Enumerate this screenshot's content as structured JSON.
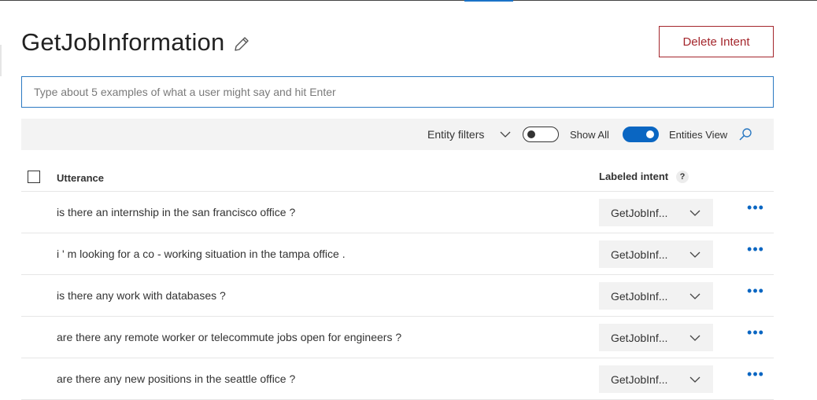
{
  "header": {
    "title": "GetJobInformation",
    "delete_label": "Delete Intent"
  },
  "input": {
    "placeholder": "Type about 5 examples of what a user might say and hit Enter",
    "value": ""
  },
  "toolbar": {
    "entity_filters_label": "Entity filters",
    "show_all_label": "Show All",
    "show_all_on": false,
    "entities_view_label": "Entities View",
    "entities_view_on": true
  },
  "table": {
    "columns": {
      "utterance": "Utterance",
      "labeled_intent": "Labeled intent",
      "help": "?"
    },
    "rows": [
      {
        "utterance": "is there an internship in the san francisco office ?",
        "intent": "GetJobInf..."
      },
      {
        "utterance": "i ' m looking for a co - working situation in the tampa office .",
        "intent": "GetJobInf..."
      },
      {
        "utterance": "is there any work with databases ?",
        "intent": "GetJobInf..."
      },
      {
        "utterance": "are there any remote worker or telecommute jobs open for engineers ?",
        "intent": "GetJobInf..."
      },
      {
        "utterance": "are there any new positions in the seattle office ?",
        "intent": "GetJobInf..."
      }
    ]
  },
  "icons": {
    "edit": "pencil-icon",
    "filter_chevron": "chevron-down-icon",
    "search": "search-icon",
    "row_menu": "more-icon"
  },
  "colors": {
    "accent": "#0a66c2",
    "danger": "#a4262c"
  }
}
